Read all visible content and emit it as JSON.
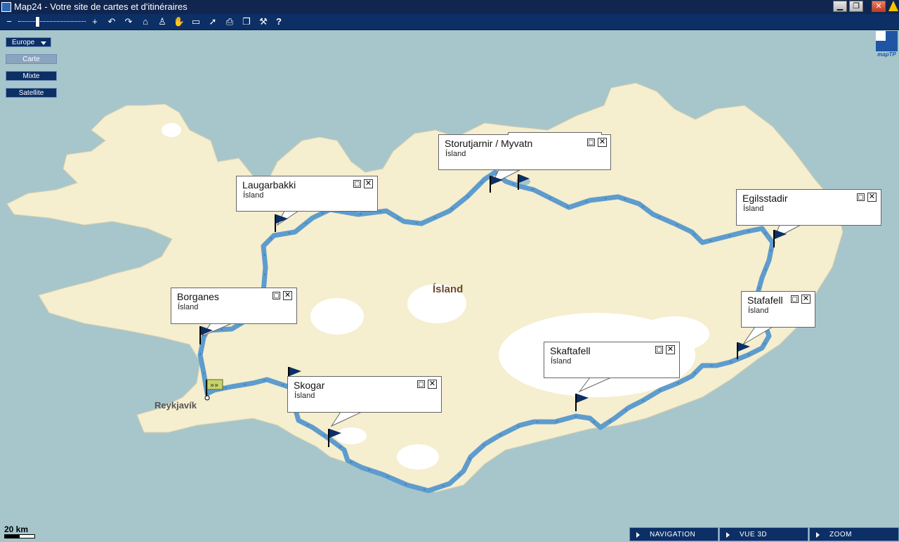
{
  "window": {
    "title": "Map24 - Votre site de cartes et d'itinéraires",
    "controls": [
      "minimize",
      "restore",
      "close",
      "warning"
    ]
  },
  "toolbar": {
    "zoom_out": "−",
    "zoom_in": "+",
    "icons": [
      "undo-icon",
      "redo-icon",
      "home-icon",
      "person-icon",
      "hand-icon",
      "measure-icon",
      "pointer-icon",
      "print-icon",
      "window-icon",
      "tools-icon",
      "help-icon"
    ],
    "help": "?"
  },
  "map_controls": {
    "region": "Europe",
    "modes": [
      "Carte",
      "Mixte",
      "Satellite"
    ],
    "active_mode": "Carte"
  },
  "logo": {
    "text": "mapTP"
  },
  "map": {
    "country_label": "Ísland",
    "city_labels": [
      "Reykjavík"
    ],
    "colors": {
      "water": "#a6c6cc",
      "land": "#f5eecf",
      "glacier": "#ffffff",
      "route": "#5e9ccd"
    }
  },
  "popups": [
    {
      "name": "Storutjarnir / Myvatn",
      "country": "Ísland"
    },
    {
      "name": "Laugarbakki",
      "country": "Ísland"
    },
    {
      "name": "Egilsstadir",
      "country": "Ísland"
    },
    {
      "name": "Borganes",
      "country": "Ísland"
    },
    {
      "name": "Stafafell",
      "country": "Ísland"
    },
    {
      "name": "Skaftafell",
      "country": "Ísland"
    },
    {
      "name": "Skogar",
      "country": "Ísland"
    }
  ],
  "scale": {
    "label": "20 km"
  },
  "bottom_nav": [
    "NAVIGATION",
    "VUE 3D",
    "ZOOM"
  ]
}
